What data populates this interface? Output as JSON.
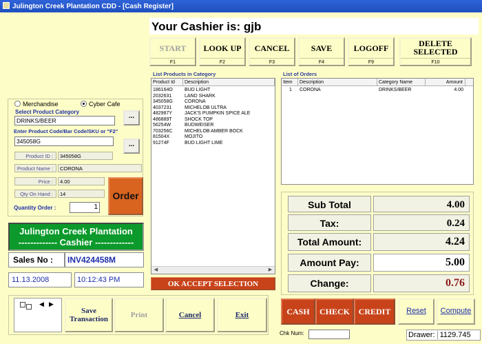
{
  "window": {
    "title": "Julington Creek Plantation CDD - [Cash Register]"
  },
  "cashier": {
    "text": "Your Cashier is: gjb"
  },
  "toolbar": [
    {
      "label": "START",
      "key": "F1",
      "enabled": false
    },
    {
      "label": "LOOK UP",
      "key": "F2",
      "enabled": true
    },
    {
      "label": "CANCEL",
      "key": "F3",
      "enabled": true
    },
    {
      "label": "SAVE",
      "key": "F4",
      "enabled": true
    },
    {
      "label": "LOGOFF",
      "key": "F9",
      "enabled": true
    },
    {
      "label": "DELETE SELECTED",
      "key": "F10",
      "enabled": true
    }
  ],
  "products": {
    "title": "List Products in Category",
    "columns": [
      "Product Id",
      "Description"
    ],
    "rows": [
      [
        "186164O",
        "BUD LIGHT"
      ],
      [
        "2032631",
        "LAND SHARK"
      ],
      [
        "345058G",
        "CORONA"
      ],
      [
        "4037231",
        "MICHELOB ULTRA"
      ],
      [
        "482987Y",
        "JACK'S PUMPKIN SPICE ALE"
      ],
      [
        "486889T",
        "SHOCK TOP"
      ],
      [
        "56254W",
        "BUDWEISER"
      ],
      [
        "703256C",
        "MICHELOB AMBER BOCK"
      ],
      [
        "81504X",
        "MOJITO"
      ],
      [
        "91274F",
        "BUD LIGHT LIME"
      ]
    ]
  },
  "orders": {
    "title": "List of Orders",
    "columns": [
      "Item",
      "Description",
      "Category Name",
      "Amount"
    ],
    "rows": [
      [
        "1",
        "CORONA",
        "DRINKS/BEER",
        "4.00"
      ]
    ]
  },
  "left": {
    "radio_merch": "Merchandise",
    "radio_cyber": "Cyber Cafe",
    "category_label": "Select Product Category",
    "category_value": "DRINKS/BEER",
    "code_label": "Enter Product Code/Bar Code/SKU or \"F2\"",
    "code_value": "345058G",
    "dots": "...",
    "product_id_label": "Product ID :",
    "product_id_value": "345058G",
    "product_name_label": "Product Name :",
    "product_name_value": "CORONA",
    "price_label": "Price :",
    "price_value": "4.00",
    "qty_hand_label": "Qty On Hand :",
    "qty_hand_value": "14",
    "qty_order_label": "Quantity Order :",
    "qty_order_value": "1",
    "order_button": "Order"
  },
  "banner": {
    "line1": "Julington Creek Plantation",
    "line2": "------------- Cashier -------------"
  },
  "sales": {
    "label": "Sales No :",
    "number": "INV424458M",
    "date": "11.13.2008",
    "time": "10:12:43 PM"
  },
  "ok_button": "OK ACCEPT SELECTION",
  "totals": {
    "sub_total_label": "Sub Total",
    "sub_total": "4.00",
    "tax_label": "Tax:",
    "tax": "0.24",
    "total_label": "Total Amount:",
    "total": "4.24",
    "pay_label": "Amount Pay:",
    "pay": "5.00",
    "change_label": "Change:",
    "change": "0.76"
  },
  "payment": {
    "cash": "CASH",
    "check": "CHECK",
    "credit": "CREDIT",
    "reset": "Reset",
    "compute": "Compute"
  },
  "bottom": {
    "save": "Save Transaction",
    "print": "Print",
    "cancel": "Cancel",
    "exit": "Exit"
  },
  "status": {
    "chk_label": "Chk Num:",
    "chk_value": "",
    "drawer_label": "Drawer:",
    "drawer_value": "1129.745"
  },
  "colors": {
    "background": "#fdfdc8",
    "title_bar": "#1e4fc0",
    "accent_orange": "#c8431a",
    "banner_green": "#0b9a2b",
    "change_red": "#8b1a1a"
  }
}
